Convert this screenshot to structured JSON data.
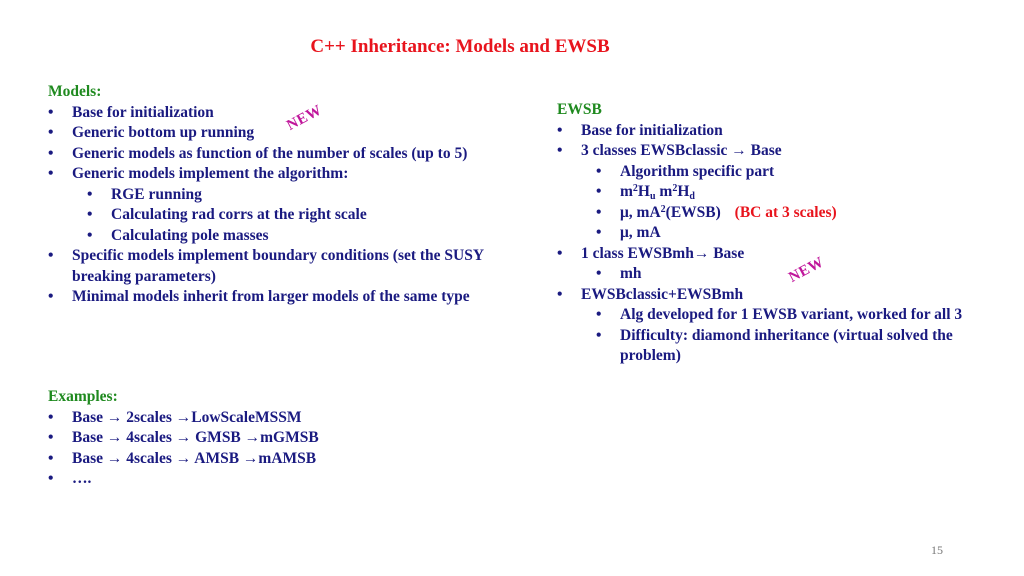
{
  "title": "C++ Inheritance: Models and EWSB",
  "badge_new": "NEW",
  "page_number": "15",
  "models": {
    "heading": "Models:",
    "items": [
      "Base for initialization",
      "Generic bottom up running",
      "Generic models as function of the number of scales (up to 5)",
      "Generic models implement the algorithm:",
      "RGE running",
      "Calculating rad corrs at the right scale",
      "Calculating pole masses",
      "Specific models implement boundary conditions (set the SUSY breaking parameters)",
      "Minimal models inherit from larger models of the same type"
    ]
  },
  "examples": {
    "heading": "Examples:",
    "items": [
      "Base → 2scales →LowScaleMSSM",
      "Base → 4scales → GMSB →mGMSB",
      "Base → 4scales → AMSB →mAMSB",
      "…."
    ]
  },
  "ewsb": {
    "heading": "EWSB",
    "items": {
      "base": "Base for initialization",
      "classic": "3 classes EWSBclassic → Base",
      "alg_part": "Algorithm specific part",
      "m2_a": "m",
      "m2_sup": "2",
      "m2_H": "H",
      "m2_u": "u",
      "m2_d": "d",
      "mu_ma2_pre": "μ, mA",
      "mu_ma2_sup": "2",
      "mu_ma2_post": "(EWSB)",
      "bc_note": "(BC at 3 scales)",
      "mu_ma": "μ, mA",
      "mh_class": "1 class EWSBmh→ Base",
      "mh": "mh",
      "combined": "EWSBclassic+EWSBmh",
      "alg_dev": "Alg developed for 1 EWSB variant, worked for all 3",
      "difficulty": "Difficulty: diamond inheritance (virtual solved the problem)"
    }
  }
}
